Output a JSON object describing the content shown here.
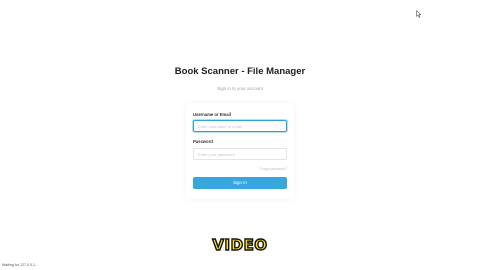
{
  "app": {
    "title": "Book Scanner - File Manager",
    "subtitle": "Sign in to your account"
  },
  "login_form": {
    "username_label": "Username or Email",
    "username_placeholder": "Enter username or email",
    "username_value": "",
    "password_label": "Password",
    "password_placeholder": "Enter your password",
    "password_value": "",
    "forgot_link": "Forgot password?",
    "signin_button": "Sign In"
  },
  "overlay": {
    "video_label": "VIDEO"
  },
  "status_bar": {
    "text": "Waiting for 127.0.0.1..."
  },
  "colors": {
    "accent": "#3aa6dc",
    "focus_border": "#2fa3d8",
    "video_text": "#ffe21f"
  },
  "icons": {
    "cursor": "mouse-pointer-icon"
  }
}
